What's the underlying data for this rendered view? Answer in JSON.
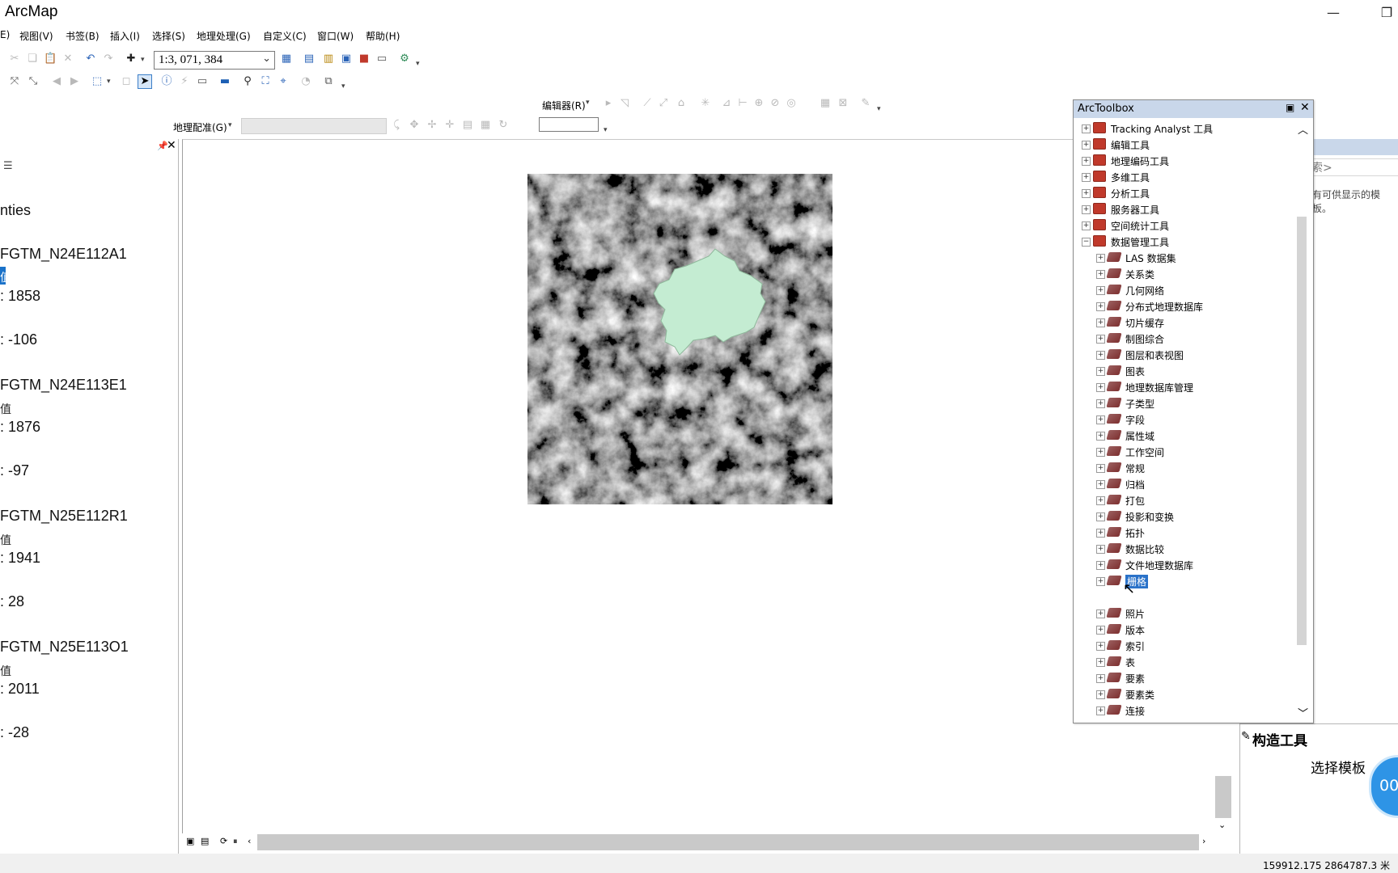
{
  "window": {
    "title": "ArcMap",
    "minimize": "—",
    "restore": "❐"
  },
  "menu": [
    {
      "label": "E)"
    },
    {
      "label": "视图(V)"
    },
    {
      "label": "书签(B)"
    },
    {
      "label": "插入(I)"
    },
    {
      "label": "选择(S)"
    },
    {
      "label": "地理处理(G)"
    },
    {
      "label": "自定义(C)"
    },
    {
      "label": "窗口(W)"
    },
    {
      "label": "帮助(H)"
    }
  ],
  "toolbar": {
    "scale": "1:3, 071, 384",
    "editor_label": "编辑器(R)",
    "georef_label": "地理配准(G)"
  },
  "toc": {
    "items": [
      {
        "text": "nties"
      },
      {
        "text": "FGTM_N24E112A1"
      },
      {
        "text": "值"
      },
      {
        "text": ": 1858"
      },
      {
        "text": ": -106"
      },
      {
        "text": "FGTM_N24E113E1"
      },
      {
        "text": "值"
      },
      {
        "text": ": 1876"
      },
      {
        "text": ": -97"
      },
      {
        "text": "FGTM_N25E112R1"
      },
      {
        "text": "值"
      },
      {
        "text": ": 1941"
      },
      {
        "text": ": 28"
      },
      {
        "text": "FGTM_N25E113O1"
      },
      {
        "text": "值"
      },
      {
        "text": ": 2011"
      },
      {
        "text": ": -28"
      }
    ]
  },
  "right_panel": {
    "search_hint": "索>",
    "template_hint": "有可供显示的模板。",
    "construct_title": "构造工具",
    "choose_template": "选择模板",
    "timer": "00:"
  },
  "toolbox": {
    "title": "ArcToolbox",
    "toolboxes": [
      {
        "label": "Tracking Analyst 工具",
        "expanded": false
      },
      {
        "label": "编辑工具",
        "expanded": false
      },
      {
        "label": "地理编码工具",
        "expanded": false
      },
      {
        "label": "多维工具",
        "expanded": false
      },
      {
        "label": "分析工具",
        "expanded": false
      },
      {
        "label": "服务器工具",
        "expanded": false
      },
      {
        "label": "空间统计工具",
        "expanded": false
      },
      {
        "label": "数据管理工具",
        "expanded": true
      }
    ],
    "toolsets": [
      {
        "label": "LAS 数据集"
      },
      {
        "label": "关系类"
      },
      {
        "label": "几何网络"
      },
      {
        "label": "分布式地理数据库"
      },
      {
        "label": "切片缓存"
      },
      {
        "label": "制图综合"
      },
      {
        "label": "图层和表视图"
      },
      {
        "label": "图表"
      },
      {
        "label": "地理数据库管理"
      },
      {
        "label": "子类型"
      },
      {
        "label": "字段"
      },
      {
        "label": "属性域"
      },
      {
        "label": "工作空间"
      },
      {
        "label": "常规"
      },
      {
        "label": "归档"
      },
      {
        "label": "打包"
      },
      {
        "label": "投影和变换"
      },
      {
        "label": "拓扑"
      },
      {
        "label": "数据比较"
      },
      {
        "label": "文件地理数据库"
      },
      {
        "label": "栅格",
        "selected": true
      },
      {
        "label": "照片"
      },
      {
        "label": "版本"
      },
      {
        "label": "索引"
      },
      {
        "label": "表"
      },
      {
        "label": "要素"
      },
      {
        "label": "要素类"
      },
      {
        "label": "连接"
      }
    ]
  },
  "status": {
    "coords": "159912.175  2864787.3 米"
  },
  "colors": {
    "selection": "#2a72c9",
    "county_fill": "#c4ecd2",
    "toolbox_title_bg": "#c9d7ea"
  }
}
